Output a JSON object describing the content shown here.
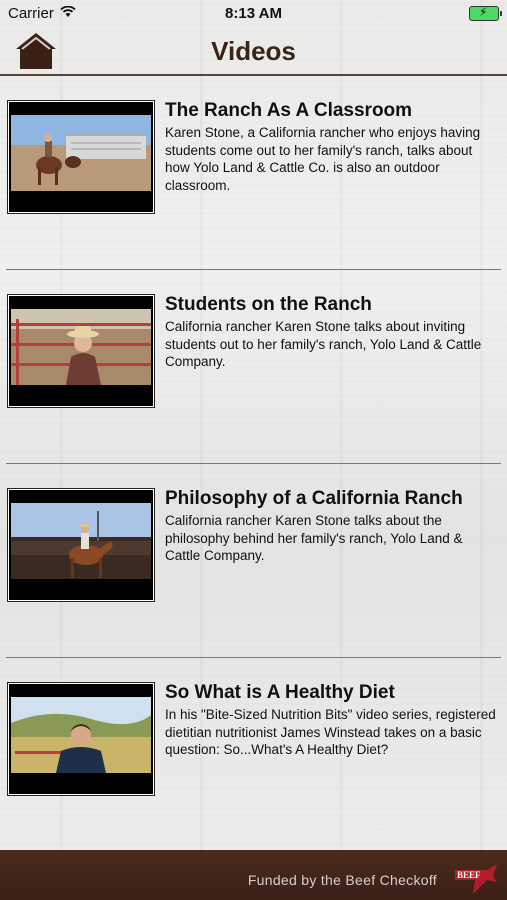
{
  "status_bar": {
    "carrier": "Carrier",
    "time": "8:13 AM"
  },
  "navbar": {
    "title": "Videos"
  },
  "videos": [
    {
      "title": "The Ranch As A Classroom",
      "description": "Karen Stone, a California rancher who enjoys having students come out to her family's ranch, talks about how Yolo Land & Cattle Co. is also an outdoor classroom."
    },
    {
      "title": "Students on the Ranch",
      "description": "California rancher Karen Stone talks about inviting students out to her family's ranch, Yolo Land & Cattle Company."
    },
    {
      "title": "Philosophy of a California Ranch",
      "description": "California rancher Karen Stone talks about the philosophy behind her family's ranch, Yolo Land & Cattle Company."
    },
    {
      "title": "So   What is A Healthy Diet",
      "description": "In his \"Bite-Sized Nutrition Bits\" video series, registered dietitian nutritionist James Winstead takes on a basic question: So...What's A Healthy Diet?"
    }
  ],
  "footer": {
    "funded_text": "Funded by the Beef Checkoff",
    "logo_text": "BEEF"
  },
  "colors": {
    "brand_brown": "#3b2016",
    "title_brown": "#3a2417",
    "battery_green": "#4cd964"
  }
}
